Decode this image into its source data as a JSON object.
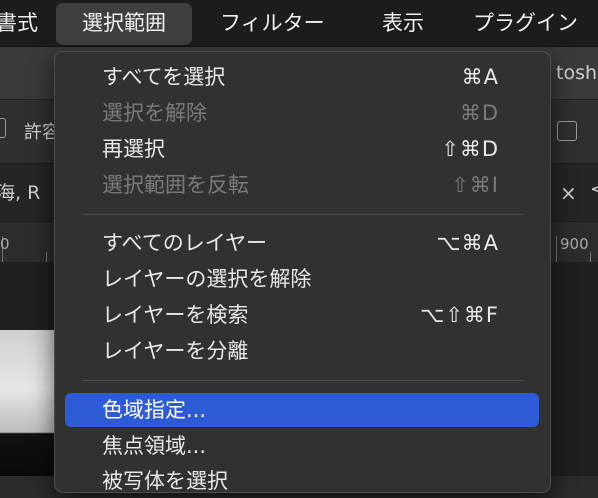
{
  "menubar": {
    "items": [
      {
        "label": "書式"
      },
      {
        "label": "選択範囲"
      },
      {
        "label": "フィルター"
      },
      {
        "label": "表示"
      },
      {
        "label": "プラグイン"
      }
    ]
  },
  "background": {
    "app_title_fragment": "tosh",
    "option_label": "許容",
    "doc_tab_fragment": "海, R",
    "ruler_left": "0",
    "ruler_right": "900"
  },
  "menu": {
    "items": [
      {
        "label": "すべてを選択",
        "shortcut": "⌘A"
      },
      {
        "label": "選択を解除",
        "shortcut": "⌘D"
      },
      {
        "label": "再選択",
        "shortcut": "⇧⌘D"
      },
      {
        "label": "選択範囲を反転",
        "shortcut": "⇧⌘I"
      },
      {
        "label": "すべてのレイヤー",
        "shortcut": "⌥⌘A"
      },
      {
        "label": "レイヤーの選択を解除",
        "shortcut": ""
      },
      {
        "label": "レイヤーを検索",
        "shortcut": "⌥⇧⌘F"
      },
      {
        "label": "レイヤーを分離",
        "shortcut": ""
      },
      {
        "label": "色域指定...",
        "shortcut": ""
      },
      {
        "label": "焦点領域...",
        "shortcut": ""
      },
      {
        "label": "被写体を選択",
        "shortcut": ""
      }
    ],
    "highlight_color": "#2d5bd6"
  }
}
